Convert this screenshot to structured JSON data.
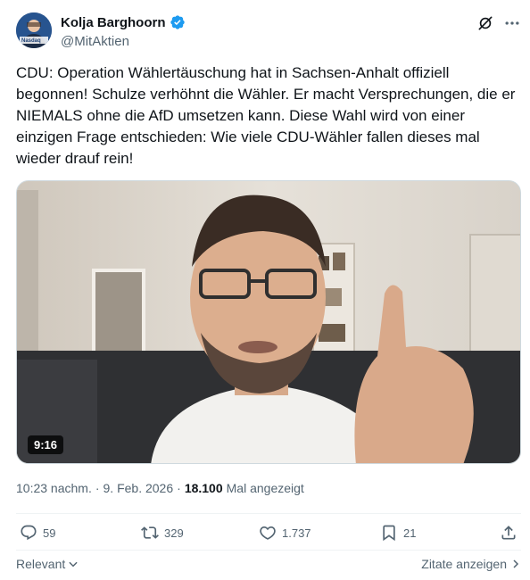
{
  "author": {
    "display_name": "Kolja Barghoorn",
    "handle": "@MitAktien",
    "verified": true,
    "avatar_badge_text": "Nasdaq"
  },
  "tweet": {
    "text": "CDU: Operation Wählertäuschung hat in Sachsen-Anhalt offiziell begonnen! Schulze verhöhnt die Wähler. Er macht Versprechungen, die er NIEMALS ohne die AfD umsetzen kann. Diese Wahl wird von einer einzigen Frage entschieden: Wie viele CDU-Wähler fallen dieses mal wieder drauf rein!"
  },
  "video": {
    "duration": "9:16"
  },
  "meta": {
    "time": "10:23 nachm.",
    "separator": "·",
    "date": "9. Feb. 2026",
    "views_count": "18.100",
    "views_label": "Mal angezeigt"
  },
  "actions": {
    "replies": "59",
    "reposts": "329",
    "likes": "1.737",
    "bookmarks": "21"
  },
  "footer": {
    "relevant_label": "Relevant",
    "quotes_label": "Zitate anzeigen"
  },
  "colors": {
    "text": "#0f1419",
    "secondary": "#536471",
    "verified": "#1d9bf0",
    "divider": "#eff3f4"
  },
  "icons": [
    "grok-icon",
    "more-icon",
    "verified-badge-icon",
    "reply-icon",
    "repost-icon",
    "like-icon",
    "bookmark-icon",
    "share-icon",
    "chevron-down-icon",
    "chevron-right-icon"
  ]
}
